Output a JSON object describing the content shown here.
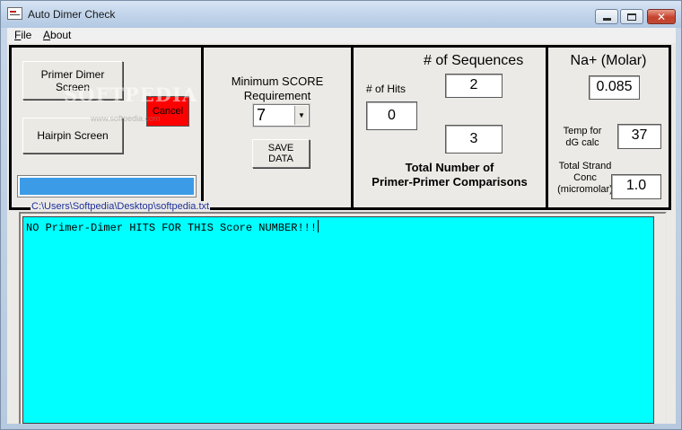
{
  "window": {
    "title": "Auto Dimer Check",
    "controls": {
      "minimize": "minimize",
      "maximize": "maximize",
      "close": "✕"
    }
  },
  "menu": {
    "file": {
      "accel": "F",
      "rest": "ile"
    },
    "about": {
      "accel": "A",
      "rest": "bout"
    }
  },
  "screen_panel": {
    "primer_dimer_button": "Primer Dimer Screen",
    "hairpin_button": "Hairpin Screen",
    "cancel_button": "Cancel",
    "progress_color": "#3c9be6",
    "watermark": "SOFTPEDIA",
    "watermark_url": "www.softpedia.com"
  },
  "score_panel": {
    "label": "Minimum SCORE Requirement",
    "selected_score": "7",
    "save_button_line1": "SAVE",
    "save_button_line2": "DATA"
  },
  "comparison_panel": {
    "sequences_label": "# of Sequences",
    "sequences_value": "2",
    "hits_label": "# of Hits",
    "hits_value": "0",
    "comparisons_value": "3",
    "comparisons_label_line1": "Total Number of",
    "comparisons_label_line2": "Primer-Primer Comparisons"
  },
  "conditions_panel": {
    "na_label": "Na+ (Molar)",
    "na_value": "0.085",
    "temp_label_line1": "Temp for",
    "temp_label_line2": "dG calc",
    "temp_value": "37",
    "strand_label_line1": "Total Strand",
    "strand_label_line2": "Conc",
    "strand_label_line3": "(micromolar)",
    "strand_value": "1.0"
  },
  "output": {
    "file_path": "C:\\Users\\Softpedia\\Desktop\\softpedia.txt",
    "text": "NO Primer-Dimer HITS FOR THIS Score NUMBER!!!",
    "background": "#00ffff"
  }
}
